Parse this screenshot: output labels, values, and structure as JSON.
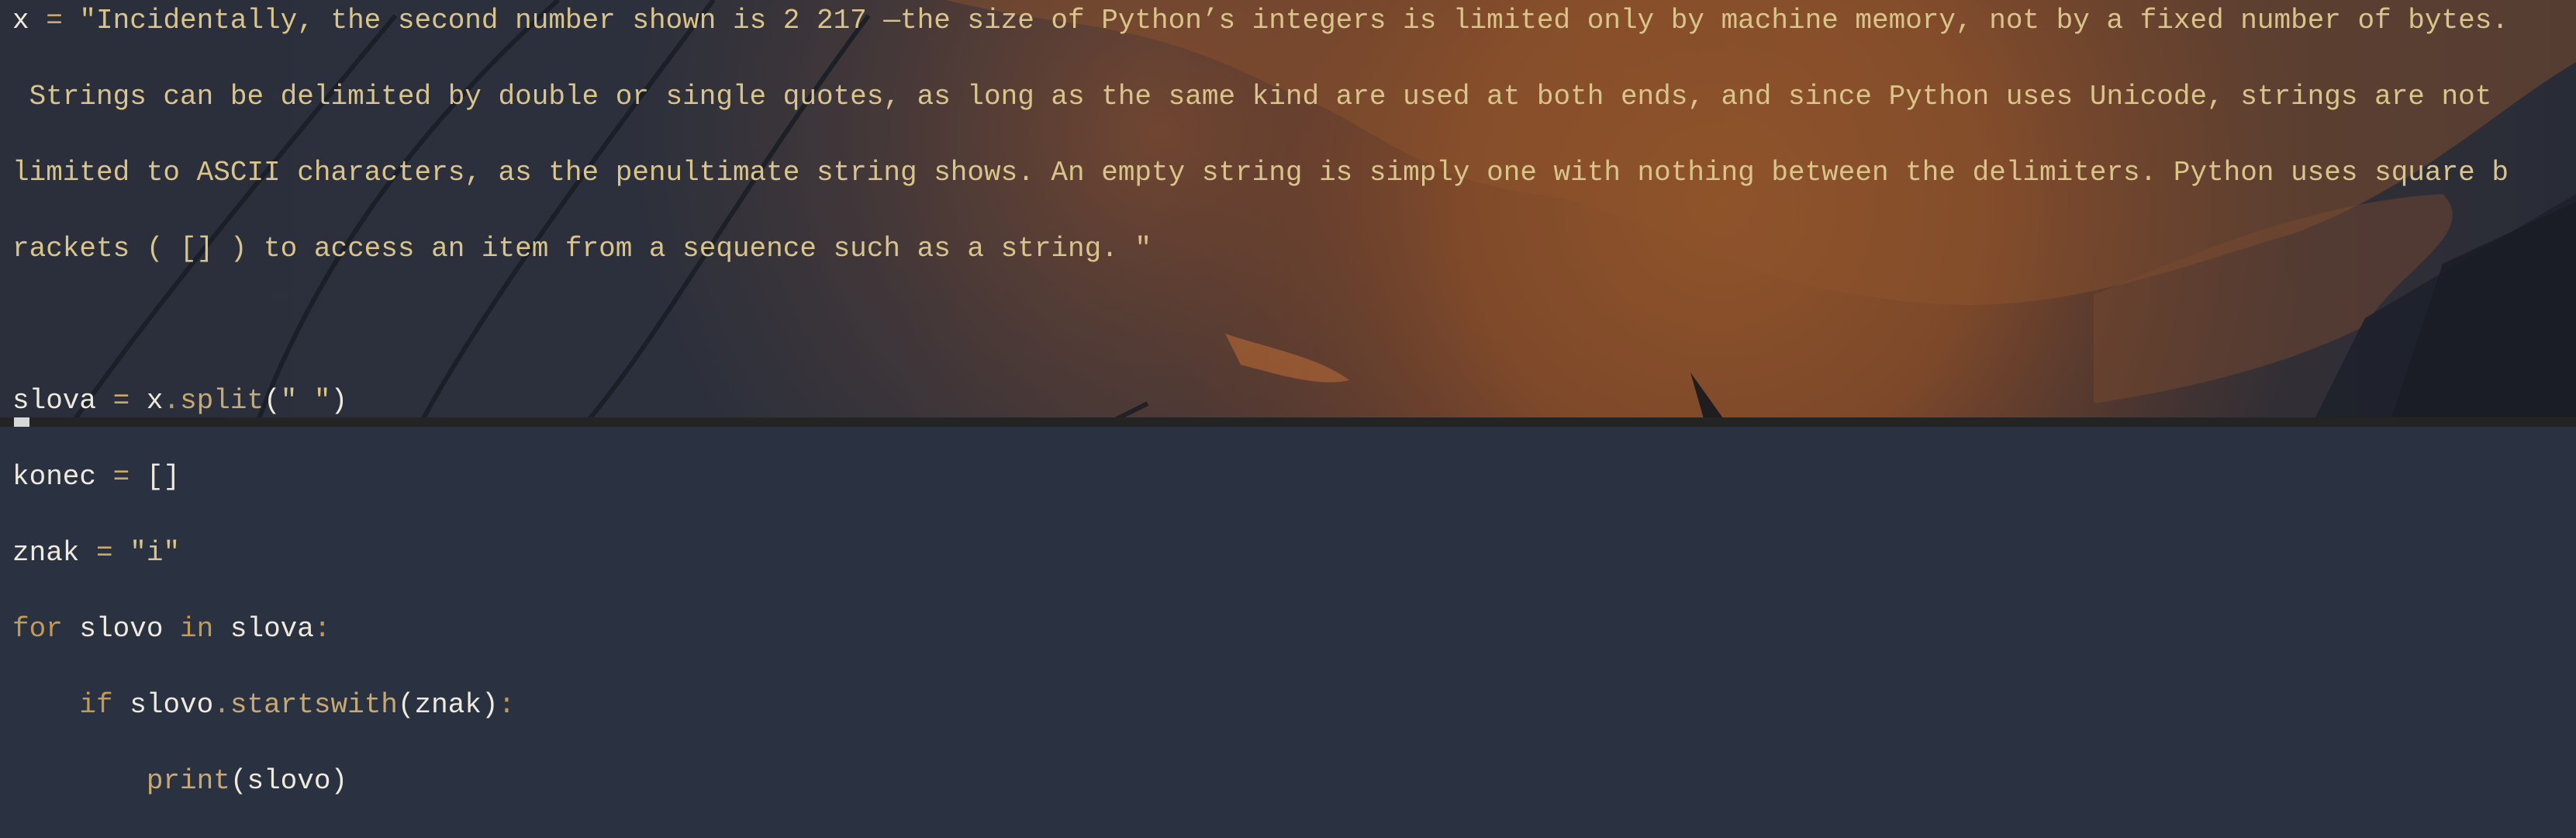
{
  "editor": {
    "line_1": {
      "var": "x",
      "op": " = ",
      "string": "\"Incidentally, the second number shown is 2 217 —the size of Python’s integers is limited only by machine memory, not by a fixed number of bytes."
    },
    "line_2": " Strings can be delimited by double or single quotes, as long as the same kind are used at both ends, and since Python uses Unicode, strings are not",
    "line_3": "limited to ASCII characters, as the penultimate string shows. An empty string is simply one with nothing between the delimiters. Python uses square b",
    "line_4": "rackets ( [] ) to access an item from a sequence such as a string. \"",
    "line_6": {
      "var": "slova",
      "op": " = ",
      "obj": "x",
      "dot": ".",
      "method": "split",
      "args_open": "(",
      "arg": "\" \"",
      "args_close": ")"
    },
    "line_7": {
      "var": "konec",
      "op": " = ",
      "value": "[]"
    },
    "line_8": {
      "var": "znak",
      "op": " = ",
      "value": "\"i\""
    },
    "line_9": {
      "kw_for": "for",
      "iter_var": " slovo ",
      "kw_in": "in",
      "iterable": " slova",
      "colon": ":"
    },
    "line_10": {
      "indent": "    ",
      "kw_if": "if",
      "obj": " slovo",
      "dot": ".",
      "method": "startswith",
      "args_open": "(",
      "arg": "znak",
      "args_close": ")",
      "colon": ":"
    },
    "line_11": {
      "indent": "        ",
      "func": "print",
      "args_open": "(",
      "arg": "slovo",
      "args_close": ")"
    }
  },
  "colors": {
    "text": "#efeade",
    "string": "#d9c48a",
    "keyword": "#c49a53",
    "background": "#2a3140",
    "status_bar": "#242424"
  }
}
